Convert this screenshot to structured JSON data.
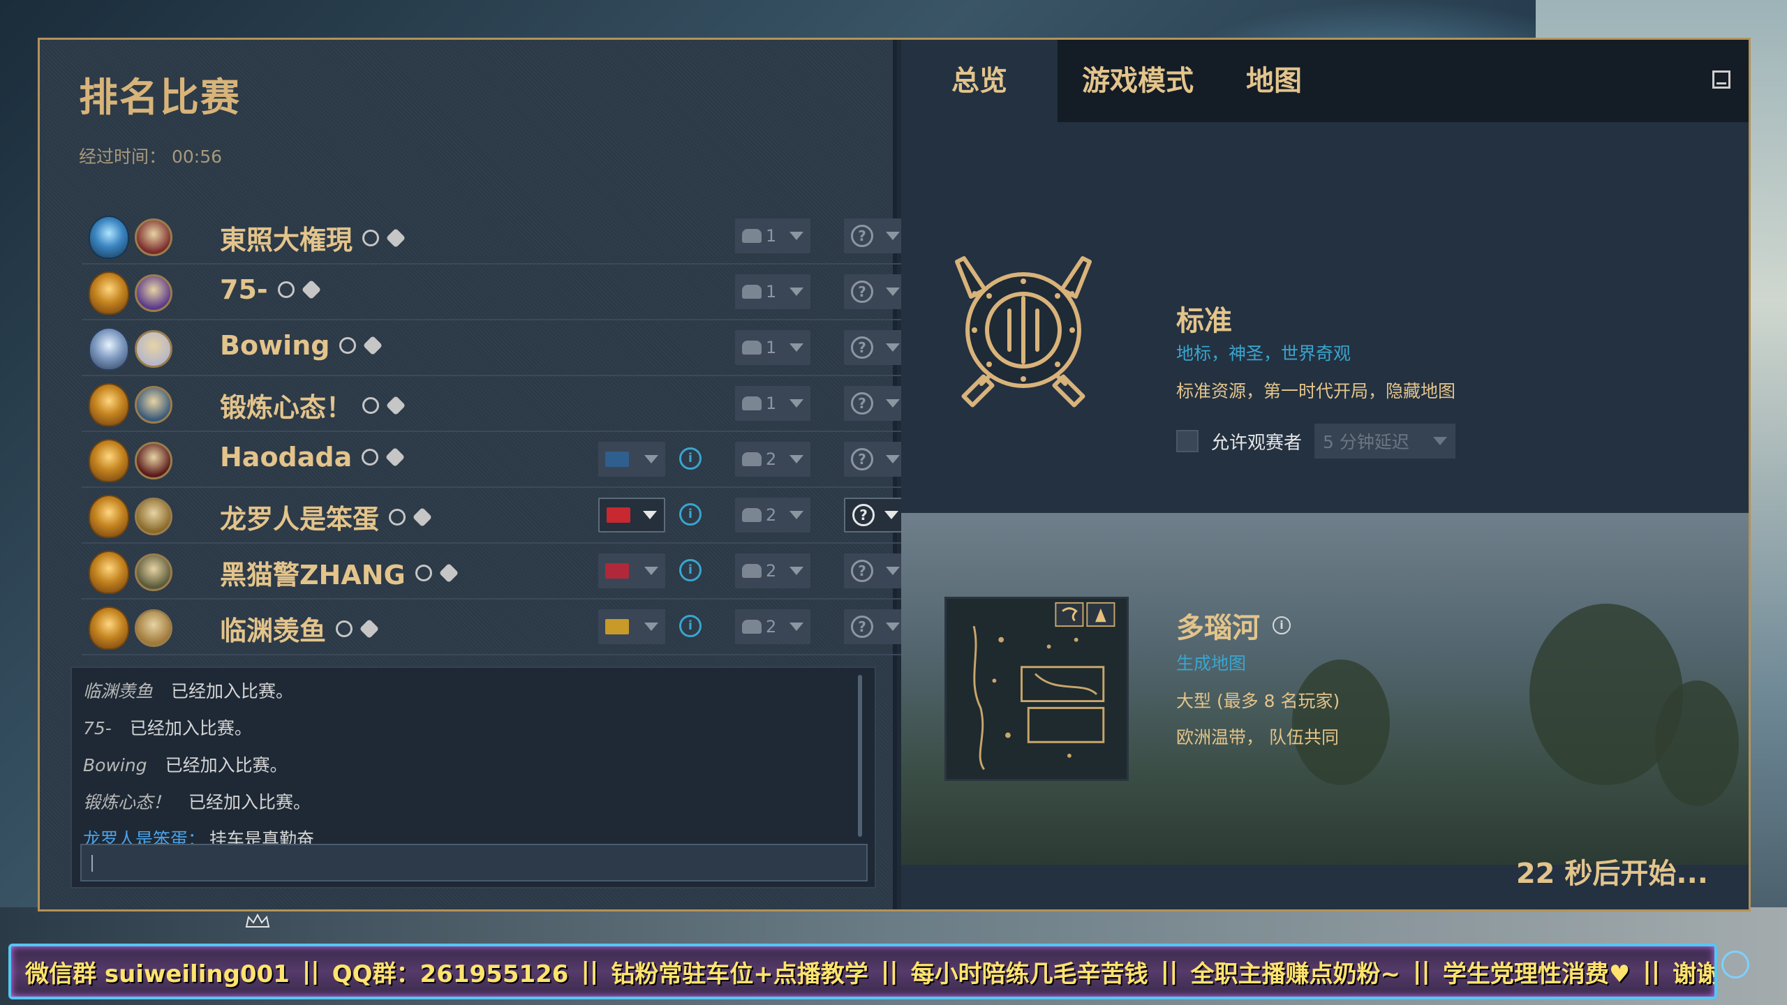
{
  "lobby": {
    "title": "排名比赛",
    "elapsed_label": "经过时间：",
    "elapsed_value": "00:56"
  },
  "players": [
    {
      "name": "東照大権現",
      "team": "1",
      "rank": "blue",
      "flag": null,
      "avatar_color": "#7a2a2a"
    },
    {
      "name": "75-",
      "team": "1",
      "rank": "gold",
      "flag": null,
      "avatar_color": "#5a3a8a"
    },
    {
      "name": "Bowing",
      "team": "1",
      "rank": "silver",
      "flag": null,
      "avatar_color": "#b7b7c9"
    },
    {
      "name": "锻炼心态！",
      "team": "1",
      "rank": "gold",
      "flag": null,
      "avatar_color": "#3a5a7a"
    },
    {
      "name": "Haodada",
      "team": "2",
      "rank": "gold",
      "flag": "#2f5f8f",
      "avatar_color": "#5a1a1a"
    },
    {
      "name": "龙罗人是笨蛋",
      "team": "2",
      "rank": "gold",
      "flag": "#c8282f",
      "avatar_color": "#8a6a2a"
    },
    {
      "name": "黑猫警ZHANG",
      "team": "2",
      "rank": "gold",
      "flag": "#b0283a",
      "avatar_color": "#5a5a3a"
    },
    {
      "name": "临渊羡鱼",
      "team": "2",
      "rank": "gold",
      "flag": "#c89a2a",
      "avatar_color": "#a07a3a"
    }
  ],
  "chat": {
    "messages": [
      {
        "who": "临渊羡鱼",
        "text": "已经加入比赛。",
        "style": "system"
      },
      {
        "who": "75-",
        "text": "已经加入比赛。",
        "style": "system"
      },
      {
        "who": "Bowing",
        "text": "已经加入比赛。",
        "style": "system"
      },
      {
        "who": "锻炼心态！",
        "text": "已经加入比赛。",
        "style": "system"
      },
      {
        "who": "龙罗人是笨蛋：",
        "text": "挂车是真勤奋",
        "style": "user"
      }
    ],
    "input_value": ""
  },
  "tabs": {
    "overview": "总览",
    "game_mode": "游戏模式",
    "map": "地图"
  },
  "game_mode": {
    "title": "标准",
    "tags": "地标，神圣，世界奇观",
    "description": "标准资源，第一时代开局，隐藏地图",
    "spectator_label": "允许观赛者",
    "delay_value": "5 分钟延迟"
  },
  "map": {
    "title": "多瑙河",
    "generation": "生成地图",
    "size": "大型 (最多 8 名玩家)",
    "climate": "欧洲温带， 队伍共同"
  },
  "countdown": "22 秒后开始...",
  "ticker": {
    "items": [
      "微信群 suiweiling001",
      "QQ群：261955126",
      "钻粉常驻车位+点播教学",
      "每小时陪练几毛辛苦钱",
      "全职主播赚点奶粉~",
      "学生党理性消费♥",
      "谢谢支持♥"
    ],
    "separator": "||"
  },
  "colors": {
    "gold_text": "#e3c48b",
    "blue_text": "#3aa5ce",
    "frame": "#b3935a"
  }
}
